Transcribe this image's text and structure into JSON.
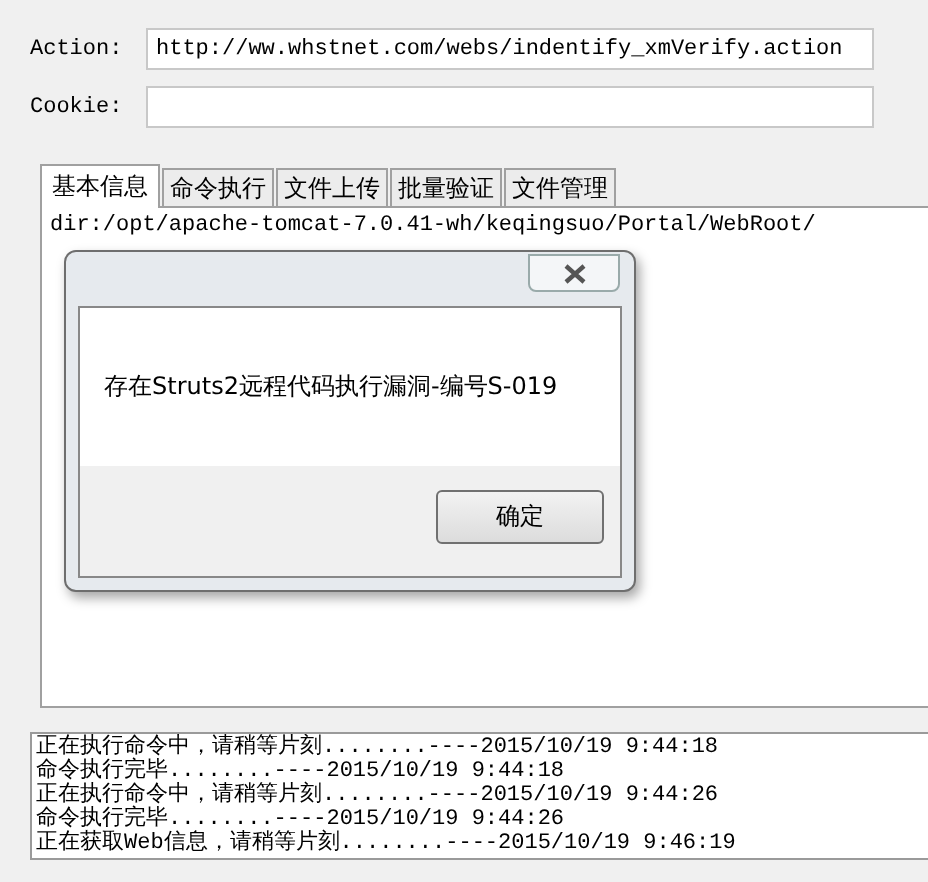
{
  "form": {
    "fields": [
      {
        "label": "Action:",
        "value": "http://ww.whstnet.com/webs/indentify_xmVerify.action"
      },
      {
        "label": "Cookie:"
      }
    ]
  },
  "tabs": [
    {
      "label": "基本信息",
      "selected": true
    },
    {
      "label": "命令执行",
      "selected": false
    },
    {
      "label": "文件上传",
      "selected": false
    },
    {
      "label": "批量验证",
      "selected": false
    },
    {
      "label": "文件管理",
      "selected": false
    }
  ],
  "panel": {
    "path": "dir:/opt/apache-tomcat-7.0.41-wh/keqingsuo/Portal/WebRoot/"
  },
  "dialog": {
    "message": "存在Struts2远程代码执行漏洞-编号S-019",
    "button": "确定"
  },
  "log": [
    "正在执行命令中，请稍等片刻........----2015/10/19 9:44:18",
    "命令执行完毕........----2015/10/19 9:44:18",
    "正在执行命令中，请稍等片刻........----2015/10/19 9:44:26",
    "命令执行完毕........----2015/10/19 9:44:26",
    "正在获取Web信息，请稍等片刻........----2015/10/19 9:46:19"
  ]
}
